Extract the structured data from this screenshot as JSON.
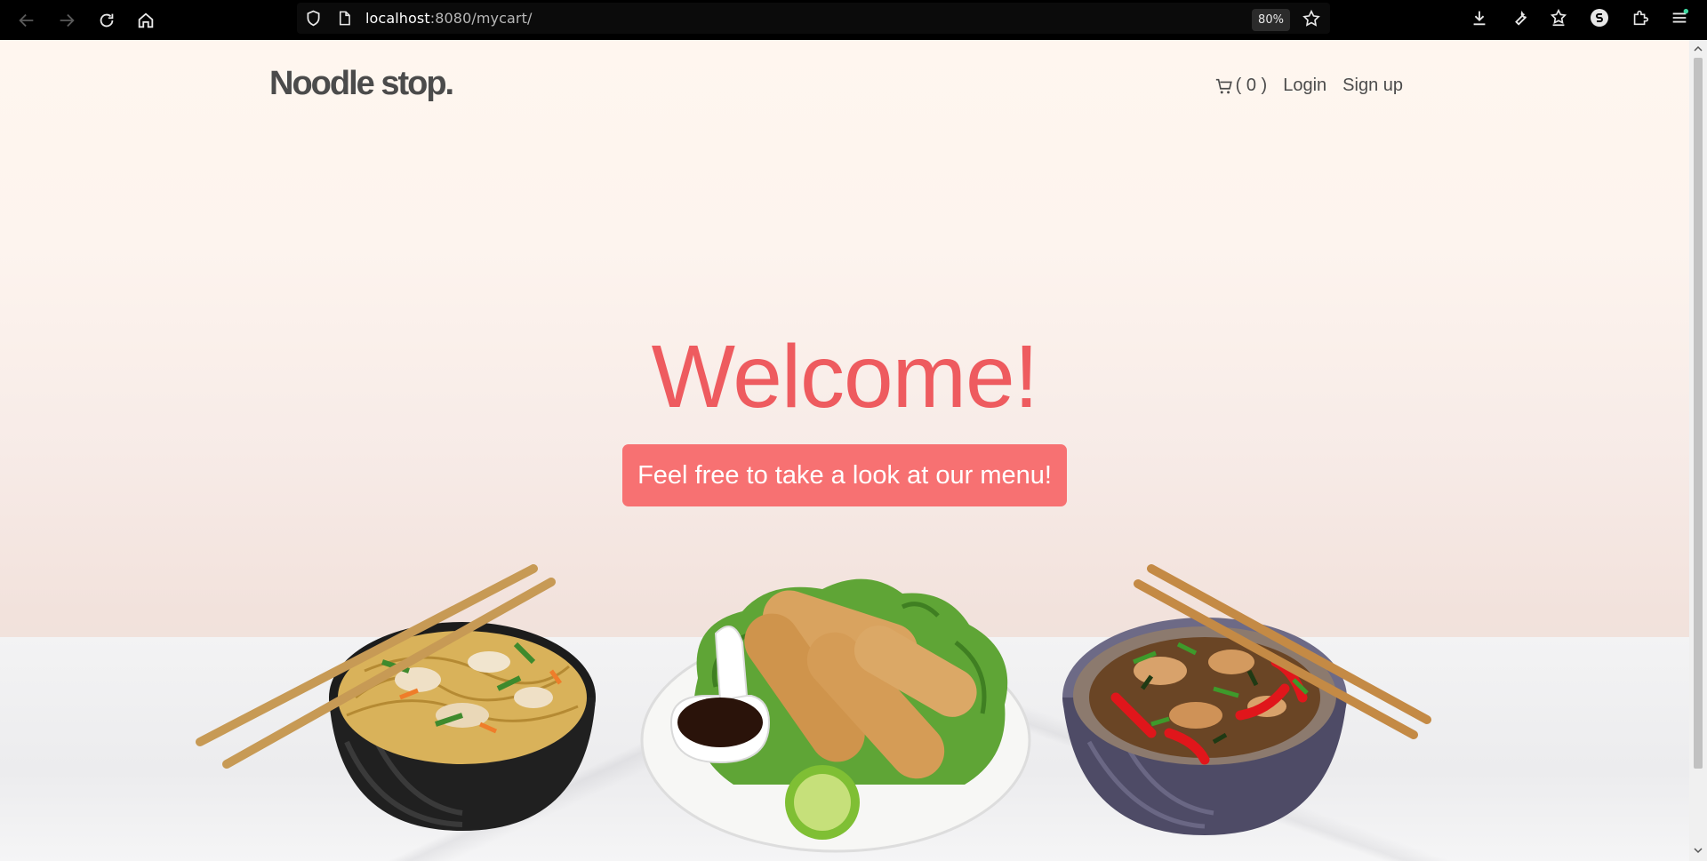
{
  "browser": {
    "url_host": "localhost",
    "url_path": ":8080/mycart/",
    "zoom": "80%"
  },
  "site": {
    "brand": "Noodle stop.",
    "cart_count": "( 0 )",
    "login": "Login",
    "signup": "Sign up"
  },
  "hero": {
    "title": "Welcome!",
    "cta": "Feel free to take a look at our menu!"
  },
  "colors": {
    "accent": "#ee5b5f",
    "button": "#f77172",
    "text": "#4b4b4b"
  },
  "icons": {
    "back": "arrow-left-icon",
    "forward": "arrow-right-icon",
    "reload": "reload-icon",
    "home": "home-icon",
    "shield": "shield-icon",
    "page": "page-icon",
    "bookmark": "star-icon",
    "download": "download-icon",
    "tools": "wrench-icon",
    "collections": "star-list-icon",
    "account": "account-icon",
    "extensions": "puzzle-icon",
    "menu": "hamburger-icon",
    "cart": "cart-icon"
  }
}
